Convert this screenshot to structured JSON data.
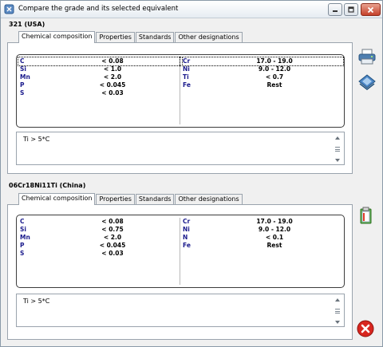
{
  "window": {
    "title": "Compare the grade and its selected equivalent",
    "app_icon": "app-icon"
  },
  "tabs": [
    "Chemical composition",
    "Properties",
    "Standards",
    "Other designations"
  ],
  "grades": [
    {
      "label": "321 (USA)",
      "left_rows": [
        {
          "el": "C",
          "val": "< 0.08"
        },
        {
          "el": "Si",
          "val": "< 1.0"
        },
        {
          "el": "Mn",
          "val": "< 2.0"
        },
        {
          "el": "P",
          "val": "< 0.045"
        },
        {
          "el": "S",
          "val": "< 0.03"
        }
      ],
      "right_rows": [
        {
          "el": "Cr",
          "val": "17.0 - 19.0"
        },
        {
          "el": "Ni",
          "val": "9.0 - 12.0"
        },
        {
          "el": "Ti",
          "val": "< 0.7"
        },
        {
          "el": "Fe",
          "val": "Rest"
        }
      ],
      "note": "Ti > 5*C"
    },
    {
      "label": "06Cr18Ni11Ti (China)",
      "left_rows": [
        {
          "el": "C",
          "val": "< 0.08"
        },
        {
          "el": "Si",
          "val": "< 0.75"
        },
        {
          "el": "Mn",
          "val": "< 2.0"
        },
        {
          "el": "P",
          "val": "< 0.045"
        },
        {
          "el": "S",
          "val": "< 0.03"
        }
      ],
      "right_rows": [
        {
          "el": "Cr",
          "val": "17.0 - 19.0"
        },
        {
          "el": "Ni",
          "val": "9.0 - 12.0"
        },
        {
          "el": "N",
          "val": "< 0.1"
        },
        {
          "el": "Fe",
          "val": "Rest"
        }
      ],
      "note": "Ti > 5*C"
    }
  ],
  "side_buttons": [
    "printer-icon",
    "save-disk-icon",
    "copy-clipboard-icon",
    "close-circle-icon"
  ],
  "colors": {
    "titlebar_close": "#c4402a",
    "close_icon": "#d8261f",
    "element_symbol": "#1a1a8c"
  }
}
